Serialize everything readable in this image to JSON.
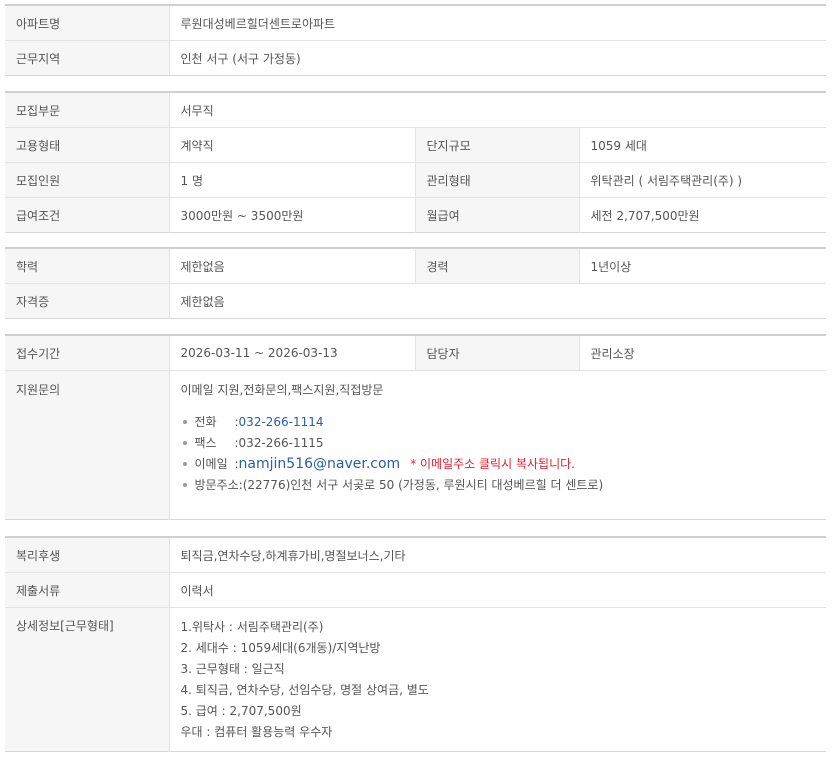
{
  "block1": {
    "apartment": {
      "label": "아파트명",
      "value": "루원대성베르힐더센트로아파트"
    },
    "region": {
      "label": "근무지역",
      "value": "인천  서구 (서구 가정동)"
    }
  },
  "block2": {
    "department": {
      "label": "모집부문",
      "value": "서무직"
    },
    "employment_type": {
      "label": "고용형태",
      "value": "계약직"
    },
    "complex_size": {
      "label": "단지규모",
      "value": "1059 세대"
    },
    "headcount": {
      "label": "모집인원",
      "value": "1 명"
    },
    "management_type": {
      "label": "관리형태",
      "value": "위탁관리 ( 서림주택관리(주) )"
    },
    "salary_terms": {
      "label": "급여조건",
      "value": "3000만원 ~ 3500만원"
    },
    "monthly_pay": {
      "label": "월급여",
      "value": "세전 2,707,500만원"
    }
  },
  "block3": {
    "education": {
      "label": "학력",
      "value": "제한없음"
    },
    "experience": {
      "label": "경력",
      "value": "1년이상"
    },
    "certificate": {
      "label": "자격증",
      "value": "제한없음"
    }
  },
  "block4": {
    "period": {
      "label": "접수기간",
      "value": "2026-03-11 ~ 2026-03-13"
    },
    "manager": {
      "label": "담당자",
      "value": "관리소장"
    },
    "contact": {
      "label": "지원문의",
      "methods": "이메일 지원,전화문의,팩스지원,직접방문",
      "phone": {
        "label": "전화",
        "sep": ":",
        "value": "032-266-1114"
      },
      "fax": {
        "label": "팩스",
        "sep": ":",
        "value": "032-266-1115"
      },
      "email": {
        "label": "이메일",
        "sep": ":",
        "value": "namjin516@naver.com",
        "note": "* 이메일주소 클릭시 복사됩니다."
      },
      "address": {
        "label": "방문주소",
        "sep": ":",
        "value": "(22776)인천 서구 서곶로 50 (가정동, 루원시티 대성베르힐 더 센트로)"
      }
    }
  },
  "block5": {
    "welfare": {
      "label": "복리후생",
      "value": "퇴직금,연차수당,하계휴가비,명절보너스,기타"
    },
    "documents": {
      "label": "제출서류",
      "value": "이력서"
    },
    "details": {
      "label": "상세정보[근무형태]",
      "lines": [
        "1.위탁사 : 서림주택관리(주)",
        "2. 세대수 : 1059세대(6개동)/지역난방",
        "3. 근무형태 : 일근직",
        "4. 퇴직금, 연차수당, 선임수당, 명절 상여금, 별도",
        "5. 급여 : 2,707,500원",
        "우대 : 컴퓨터 활용능력 우수자"
      ]
    }
  },
  "colors": {
    "label_bg": "#f6f6f6",
    "link": "#2a5dab",
    "warning": "#e5202e",
    "border": "#e3e3e3"
  }
}
